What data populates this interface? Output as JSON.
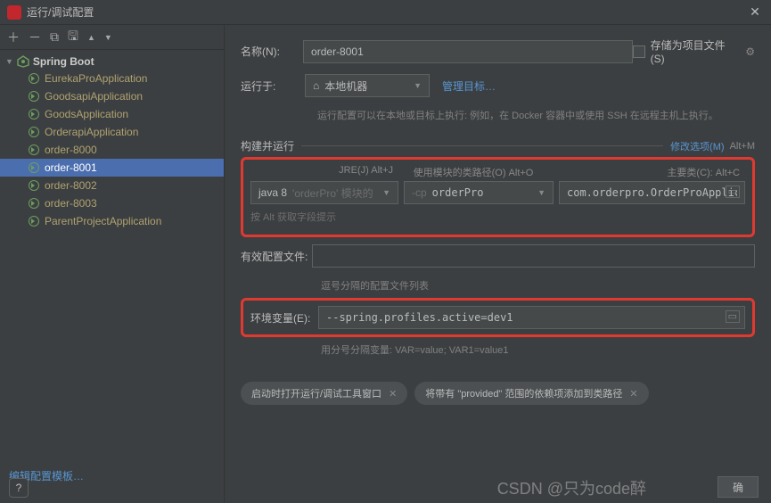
{
  "titlebar": {
    "title": "运行/调试配置"
  },
  "toolbar": {
    "add": "＋",
    "remove": "－",
    "copy": "⧉",
    "save": "🖫",
    "up": "▲",
    "down": "▼"
  },
  "tree": {
    "root": "Spring Boot",
    "items": [
      {
        "label": "EurekaProApplication",
        "selected": false
      },
      {
        "label": "GoodsapiApplication",
        "selected": false
      },
      {
        "label": "GoodsApplication",
        "selected": false
      },
      {
        "label": "OrderapiApplication",
        "selected": false
      },
      {
        "label": "order-8000",
        "selected": false
      },
      {
        "label": "order-8001",
        "selected": true
      },
      {
        "label": "order-8002",
        "selected": false
      },
      {
        "label": "order-8003",
        "selected": false
      },
      {
        "label": "ParentProjectApplication",
        "selected": false
      }
    ]
  },
  "form": {
    "name_label": "名称(N):",
    "name_value": "order-8001",
    "store_label": "存储为项目文件(S)",
    "runon_label": "运行于:",
    "runon_value": "本地机器",
    "manage_targets": "管理目标…",
    "runon_hint": "运行配置可以在本地或目标上执行: 例如，在 Docker 容器中或使用 SSH 在远程主机上执行。",
    "build_title": "构建并运行",
    "modify_link": "修改选项(M)",
    "modify_shortcut": "Alt+M",
    "jre_hint": "JRE(J) Alt+J",
    "cp_hint": "使用模块的类路径(O) Alt+O",
    "main_hint": "主要类(C): Alt+C",
    "jre_value": "java 8",
    "jre_suffix": "'orderPro' 模块的",
    "cp_prefix": "-cp",
    "cp_value": "orderPro",
    "main_class": "com.orderpro.OrderProApplication",
    "alt_hint": "按 Alt 获取字段提示",
    "eff_label": "有效配置文件:",
    "eff_hint": "逗号分隔的配置文件列表",
    "env_label": "环境变量(E):",
    "env_value": "--spring.profiles.active=dev1",
    "env_hint": "用分号分隔变量: VAR=value; VAR1=value1",
    "chip1": "启动时打开运行/调试工具窗口",
    "chip2": "将带有 \"provided\" 范围的依赖项添加到类路径"
  },
  "footer": {
    "edit_templates": "编辑配置模板…",
    "ok": "确"
  },
  "watermark": "CSDN @只为code醉"
}
